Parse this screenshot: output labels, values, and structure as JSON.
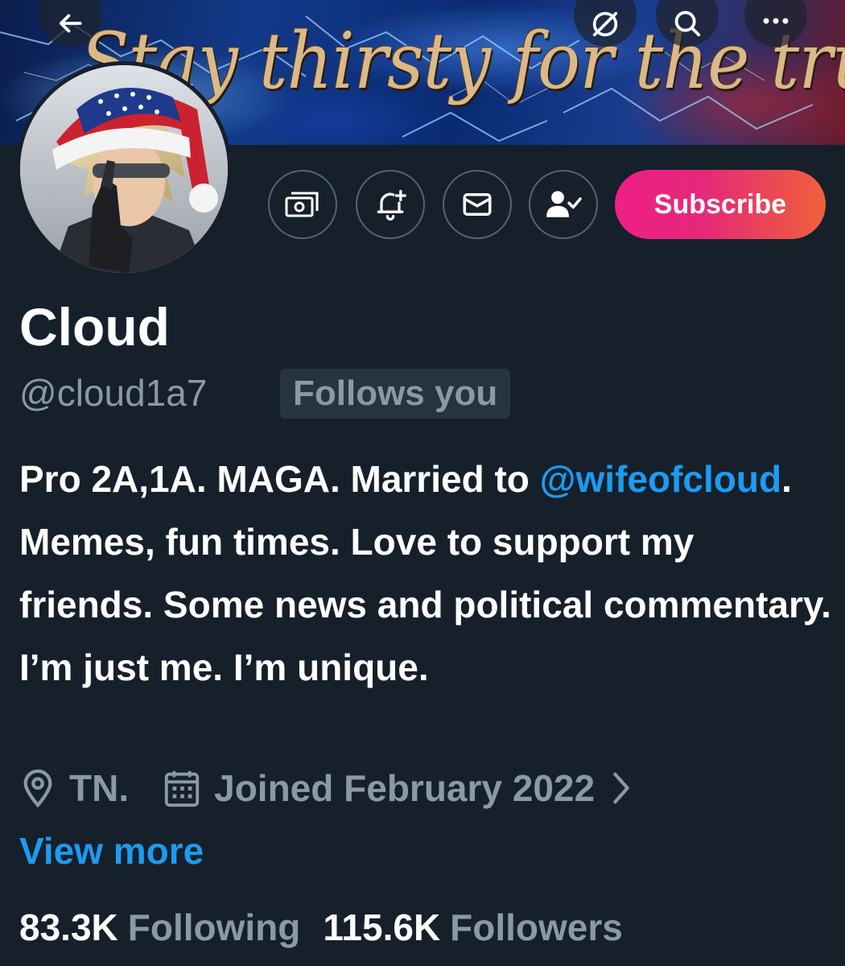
{
  "banner": {
    "text": "Stay thirsty for the truth."
  },
  "top_bar": {
    "back_icon": "arrow-left-icon",
    "grok_icon": "grok-icon",
    "search_icon": "search-icon",
    "more_icon": "more-horizontal-icon"
  },
  "actions": {
    "tip_icon": "money-tip-icon",
    "notify_icon": "bell-plus-icon",
    "message_icon": "envelope-icon",
    "following_icon": "person-check-icon",
    "subscribe_label": "Subscribe"
  },
  "profile": {
    "display_name": "Cloud",
    "handle": "@cloud1a7",
    "follows_badge": "Follows you",
    "bio_part1": "Pro 2A,1A. MAGA. Married to ",
    "bio_mention": "@wifeofcloud",
    "bio_part2": ". Memes, fun times. Love to support my friends. Some news and political commentary. I’m just me. I’m unique.",
    "location": "TN.",
    "joined": "Joined February 2022",
    "view_more": "View more"
  },
  "stats": {
    "following_count": "83.3K",
    "following_label": "Following",
    "followers_count": "115.6K",
    "followers_label": "Followers"
  },
  "colors": {
    "background": "#15202b",
    "accent": "#1d9bf0",
    "muted": "#8b98a5",
    "subscribe_gradient_start": "#f01f87",
    "subscribe_gradient_end": "#f0603a"
  }
}
